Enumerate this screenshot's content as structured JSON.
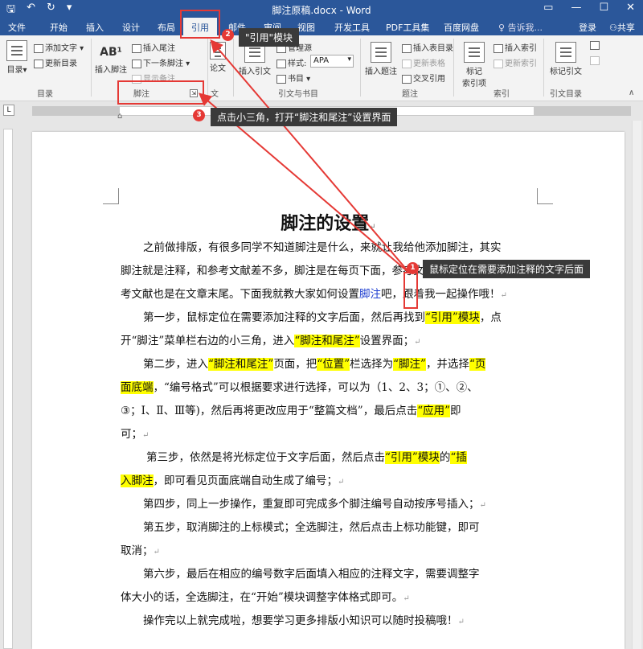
{
  "window": {
    "title": "脚注原稿.docx - Word"
  },
  "tabs": [
    "文件",
    "开始",
    "插入",
    "设计",
    "布局",
    "引用",
    "邮件",
    "审阅",
    "视图",
    "开发工具",
    "PDF工具集",
    "百度网盘"
  ],
  "active_tab": "引用",
  "tell_me": "告诉我...",
  "login": "登录",
  "share": "共享",
  "ribbon": {
    "toc_label": "目录",
    "add_text": "添加文字",
    "update_toc": "更新目录",
    "insert_footnote": "插入脚注",
    "insert_endnote": "插入尾注",
    "next_footnote": "下一条脚注",
    "show_notes": "显示备注",
    "insert_citation": "插入引文",
    "manage_sources": "管理源",
    "style_label": "样式:",
    "style_value": "APA",
    "bibliography": "书目",
    "smart_lookup": "论文",
    "insert_caption": "插入题注",
    "insert_table_figures": "插入表目录",
    "update_table": "更新表格",
    "cross_reference": "交叉引用",
    "mark_entry": "标记\n索引项",
    "insert_index": "插入索引",
    "update_index": "更新索引",
    "mark_citation": "标记引文",
    "groups": {
      "toc": "目录",
      "footnotes": "脚注",
      "citations": "引文与书目",
      "captions": "题注",
      "index": "索引",
      "toa": "引文目录"
    }
  },
  "annotations": {
    "step1": "鼠标定位在需要添加注释的文字后面",
    "step2": "\"引用\"模块",
    "step3": "点击小三角，打开“脚注和尾注”设置界面",
    "n1": "1",
    "n2": "2",
    "n3": "3"
  },
  "document": {
    "title": "脚注的设置",
    "lines": [
      "之前做排版，有很多同学不知道脚注是什么，来就让我给他添加脚注，其实",
      "脚注就是注释，和参考文献差不多，脚注是在每页下面，参考文献是在",
      "考文献也是在文章末尾。下面我就教大家如何设置",
      "第一步，鼠标定位在需要添加注释的文字后面，然后再找到",
      "开“脚注”菜单栏右边的小三角，进入",
      "第二步，进入",
      "面底端",
      "③；Ⅰ、Ⅱ、Ⅲ等)，然后再将更改应用于“整篇文档”，最后点击",
      "可；",
      "第三步，依然是将光标定位于文字后面，然后点击",
      "入脚注",
      "第四步，同上一步操作，重复即可完成多个脚注编号自动按序号插入；",
      "第五步，取消脚注的上标模式；全选脚注，然后点击上标功能键，即可",
      "取消；",
      "第六步，最后在相应的编号数字后面填入相应的注释文字，需要调整字",
      "体大小的话，全选脚注，在“开始”模块调整字体格式即可。",
      "操作完以上就完成啦，想要学习更多排版小知识可以随时投稿哦！"
    ],
    "frag": {
      "footnote_word": "脚注",
      "follow_me": "吧，跟着我一起操作哦！",
      "yinyong_block": "“引用”模块",
      "dian": "，点",
      "footnote_endnote": "“脚注和尾注”",
      "settings_page": "设置界面；",
      "page_put": "页面，把",
      "position": "“位置”",
      "bar_choose": "栏选择为",
      "footnote_q": "“脚注”",
      "and_choose": "，并选择",
      "ye": "“页",
      "format_text": "，“编号格式”可以根据要求进行选择，可以为（1、2、3；①、②、",
      "apply": "“应用”",
      "ji": "即",
      "yinyong_block2": "“引用”模块",
      "de": "的",
      "cha": "“插",
      "see_below": "，即可看见页面底端自动生成了编号；"
    }
  }
}
